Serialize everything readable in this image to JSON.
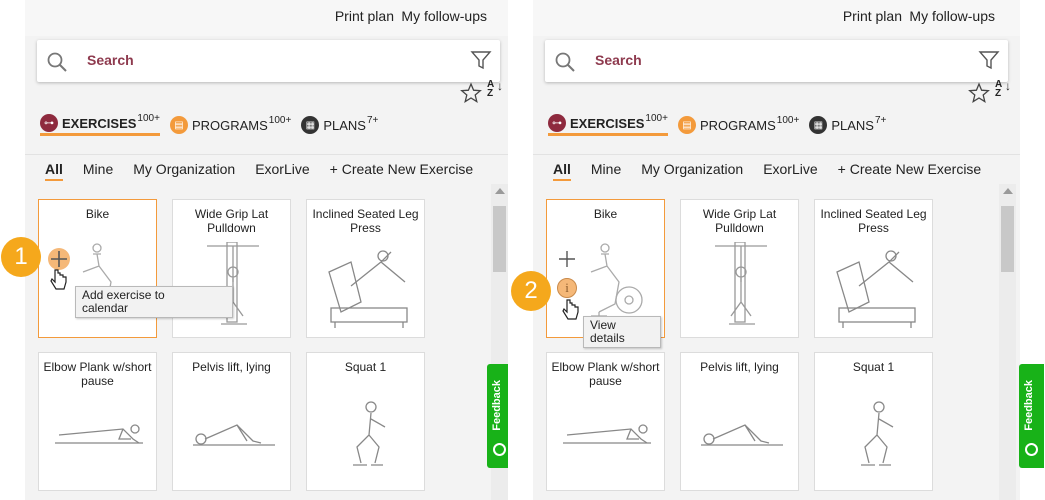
{
  "topbar": {
    "print_plan": "Print plan",
    "follow_ups": "My follow-ups"
  },
  "search": {
    "placeholder": "Search"
  },
  "sort": {
    "a": "A",
    "z": "Z"
  },
  "categories": [
    {
      "label": "EXERCISES",
      "count": "100+",
      "color": "#8e2a3e"
    },
    {
      "label": "PROGRAMS",
      "count": "100+",
      "color": "#f39a3b"
    },
    {
      "label": "PLANS",
      "count": "7+",
      "color": "#333333"
    }
  ],
  "filters": [
    "All",
    "Mine",
    "My Organization",
    "ExorLive",
    "+ Create New Exercise"
  ],
  "exercises": [
    {
      "title": "Bike"
    },
    {
      "title": "Wide Grip Lat Pulldown"
    },
    {
      "title": "Inclined Seated Leg Press"
    },
    {
      "title": "Elbow Plank w/short pause"
    },
    {
      "title": "Pelvis lift, lying"
    },
    {
      "title": "Squat 1"
    }
  ],
  "feedback": {
    "label": "Feedback"
  },
  "steps": [
    "1",
    "2"
  ],
  "tooltips": {
    "add_line1": "Add exercise to",
    "add_line2": "calendar",
    "view_line1": "View",
    "view_line2": "details"
  },
  "info_glyph": "i",
  "colors": {
    "accent": "#f39a3b",
    "feedback": "#18b218",
    "step": "#f5a81c",
    "search_text": "#8e3a4e"
  }
}
